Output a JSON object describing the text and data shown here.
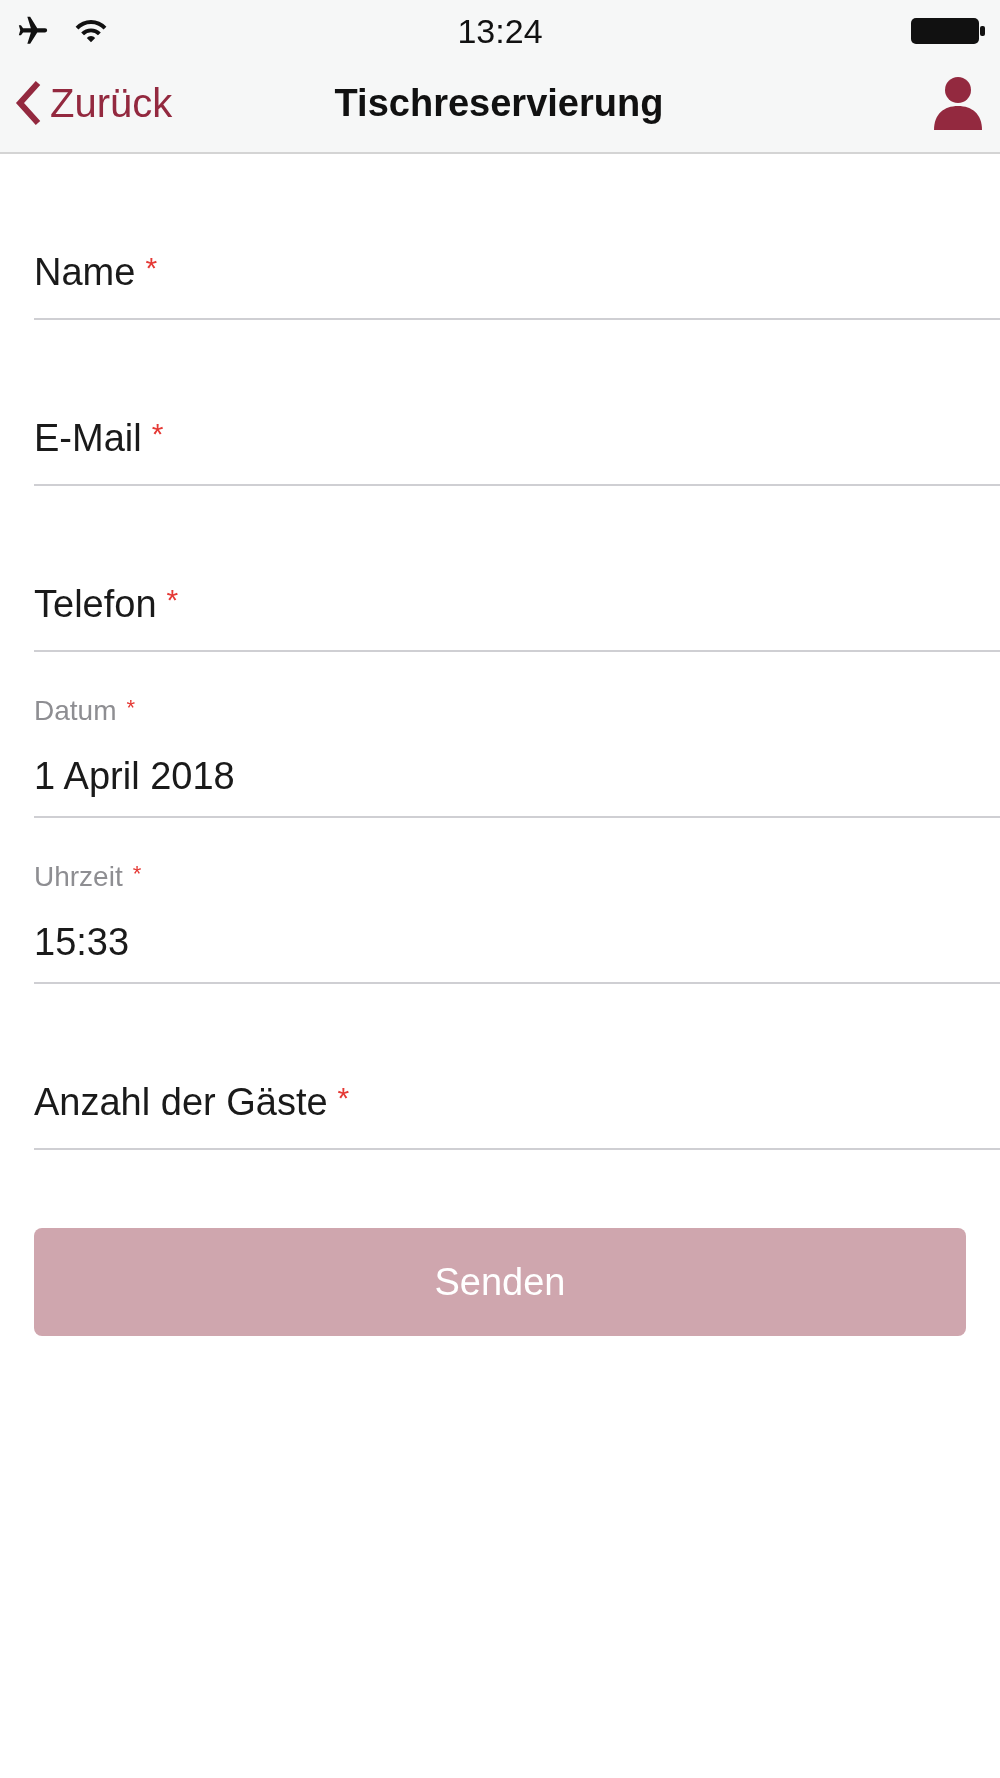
{
  "status_bar": {
    "time": "13:24"
  },
  "nav": {
    "back_label": "Zurück",
    "title": "Tischreservierung"
  },
  "fields": [
    {
      "label": "Name",
      "required_mark": "*"
    },
    {
      "label": "E-Mail",
      "required_mark": "*"
    },
    {
      "label": "Telefon",
      "required_mark": "*"
    },
    {
      "label": "Datum",
      "required_mark": "*",
      "value": "1 April 2018"
    },
    {
      "label": "Uhrzeit",
      "required_mark": "*",
      "value": "15:33"
    },
    {
      "label": "Anzahl der Gäste",
      "required_mark": "*"
    }
  ],
  "submit": {
    "label": "Senden",
    "disabled": true
  }
}
